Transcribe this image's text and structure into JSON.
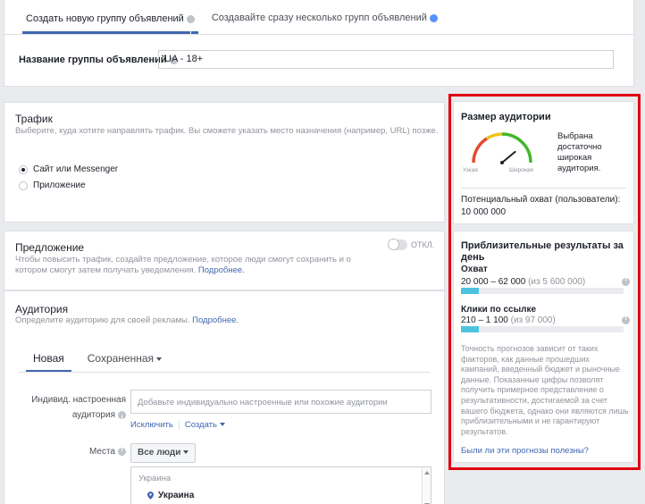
{
  "top": {
    "tabs": [
      {
        "label": "Создать новую группу объявлений",
        "active": true
      },
      {
        "label": "Создавайте сразу несколько групп объявлений",
        "active": false
      }
    ],
    "name_label": "Название группы объявлений",
    "name_value": "UA - 18+"
  },
  "traffic": {
    "title": "Трафик",
    "description": "Выберите, куда хотите направлять трафик. Вы сможете указать место назначения (например, URL) позже.",
    "options": [
      {
        "label": "Сайт или Messenger",
        "checked": true
      },
      {
        "label": "Приложение",
        "checked": false
      }
    ]
  },
  "offer": {
    "title": "Предложение",
    "description": "Чтобы повысить трафик, создайте предложение, которое люди смогут сохранить и о котором смогут затем получать уведомления.",
    "more_link": "Подробнее.",
    "toggle_label": "ОТКЛ."
  },
  "audience": {
    "title": "Аудитория",
    "description": "Определите аудиторию для своей рекламы.",
    "more_link": "Подробнее.",
    "tabs": [
      {
        "label": "Новая",
        "active": true
      },
      {
        "label": "Сохраненная",
        "active": false
      }
    ],
    "custom_label_line1": "Индивид. настроенная",
    "custom_label_line2": "аудитория",
    "custom_placeholder": "Добавьте индивидуально настроенные или похожие аудитории",
    "exclude_link": "Исключить",
    "create_link": "Создать",
    "places_label": "Места",
    "places_button": "Все люди",
    "places_region": "Украина",
    "places_country": "Украина"
  },
  "audience_size": {
    "title": "Размер аудитории",
    "gauge_left": "Узкая",
    "gauge_right": "Широкая",
    "gauge_level": 0.78,
    "summary": "Выбрана достаточно широкая аудитория.",
    "reach_label": "Потенциальный охват (пользователи):",
    "reach_value": "10 000 000"
  },
  "daily_results": {
    "title": "Приблизительные результаты за день",
    "metrics": [
      {
        "label": "Охват",
        "value": "20 000 – 62 000",
        "total": "(из 5 600 000)",
        "fill": 0.11
      },
      {
        "label": "Клики по ссылке",
        "value": "210 – 1 100",
        "total": "(из 97 000)",
        "fill": 0.11
      }
    ],
    "disclaimer": "Точность прогнозов зависит от таких факторов, как данные прошедших кампаний, введенный бюджет и рыночные данные. Показанные цифры позволят получить примерное представление о результативности, достигаемой за счет вашего бюджета, однако они являются лишь приблизительными и не гарантируют результатов.",
    "feedback_link": "Были ли эти прогнозы полезны?"
  },
  "colors": {
    "accent": "#4267b2",
    "highlight": "#e0000f",
    "bar": "#4ec3e0"
  }
}
